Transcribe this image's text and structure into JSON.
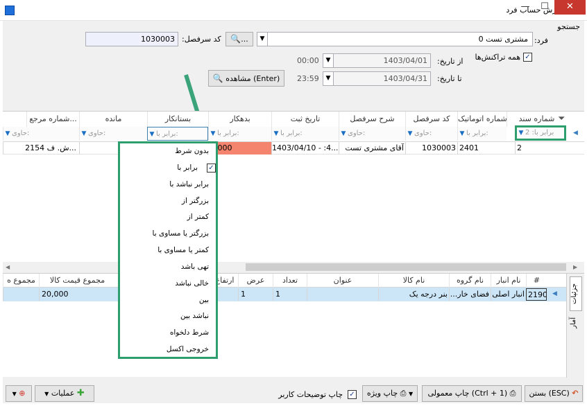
{
  "window": {
    "title": "گزارش حساب فرد",
    "min": "—",
    "max": "☐",
    "close": "✕"
  },
  "search": {
    "title": "جستجو",
    "person_label": "فرد:",
    "person_value": "مشتری تست 0",
    "more_label": "...",
    "code_label": "کد سرفصل:",
    "code_value": "1030003",
    "all_tx_label": "همه تراکنش‌ها",
    "all_tx_checked": "✓",
    "from_label": "از تاریخ:",
    "from_date": "1403/04/01",
    "from_time": "00:00",
    "to_label": "تا تاریخ:",
    "to_date": "1403/04/31",
    "to_time": "23:59",
    "view_label": "مشاهده (Enter)"
  },
  "grid": {
    "columns": [
      "شماره سند",
      "شماره اتوماتیک",
      "کد سرفصل",
      "شرح سرفصل",
      "تاریخ ثبت",
      "بدهکار",
      "بستانکار",
      "مانده",
      "شماره مرجع..."
    ],
    "filters": [
      "برابر با: 2",
      "برابر با:",
      "حاوی:",
      "حاوی:",
      "برابر با:",
      "برابر با:",
      "برابر با:",
      "حاوی:",
      "حاوی:"
    ],
    "row": [
      "2",
      "2401",
      "1030003",
      "آقای مشتری تست",
      "1403/04/10 - :4...",
      "0,000",
      "",
      "",
      "2154 ش. ف..."
    ]
  },
  "filter_menu": {
    "items": [
      "بدون شرط",
      "برابر با",
      "برابر نباشد با",
      "بزرگتر از",
      "کمتر از",
      "بزرگتر یا مساوی با",
      "کمتر یا مساوی با",
      "تهی باشد",
      "خالی نباشد",
      "بین",
      "نباشد بین",
      "شرط دلخواه",
      "خروجی اکسل"
    ],
    "checked_mark": "✓"
  },
  "lower_grid": {
    "tabs": [
      "جزئیات",
      "آمار"
    ],
    "columns": [
      "#",
      "نام انبار",
      "نام گروه",
      "نام کالا",
      "عنوان",
      "تعداد",
      "عرض",
      "ارتفاع",
      "مجموع قیمت کالا",
      "مجموع ه"
    ],
    "row": [
      "2190",
      "انبار اصلی",
      "فضای خار...",
      "بنر درجه یک",
      "",
      "1",
      "1",
      "",
      "20,000",
      ""
    ]
  },
  "footer": {
    "close_label": "بستن (ESC)",
    "print_normal_label": "چاپ معمولی (Ctrl + 1)",
    "print_special_label": "چاپ ویژه",
    "print_notes_label": "چاپ توضیحات کاربر",
    "print_notes_checked": "✓",
    "operations_label": "عملیات"
  },
  "colors": {
    "accent": "#2e9e6f",
    "debit_highlight": "#f4846e",
    "selected_row": "#cde6f7",
    "arrow": "#3aa37a"
  }
}
